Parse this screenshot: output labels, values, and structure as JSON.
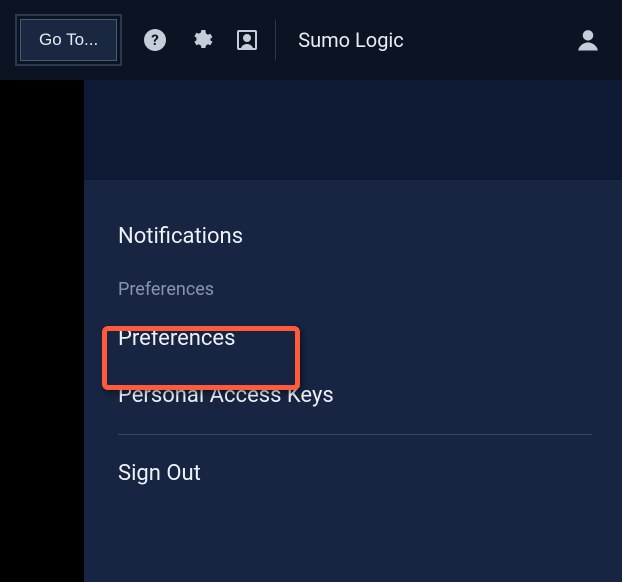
{
  "topbar": {
    "goto_label": "Go To...",
    "brand": "Sumo Logic"
  },
  "menu": {
    "notifications": "Notifications",
    "section_label": "Preferences",
    "preferences": "Preferences",
    "access_keys": "Personal Access Keys",
    "sign_out": "Sign Out"
  }
}
